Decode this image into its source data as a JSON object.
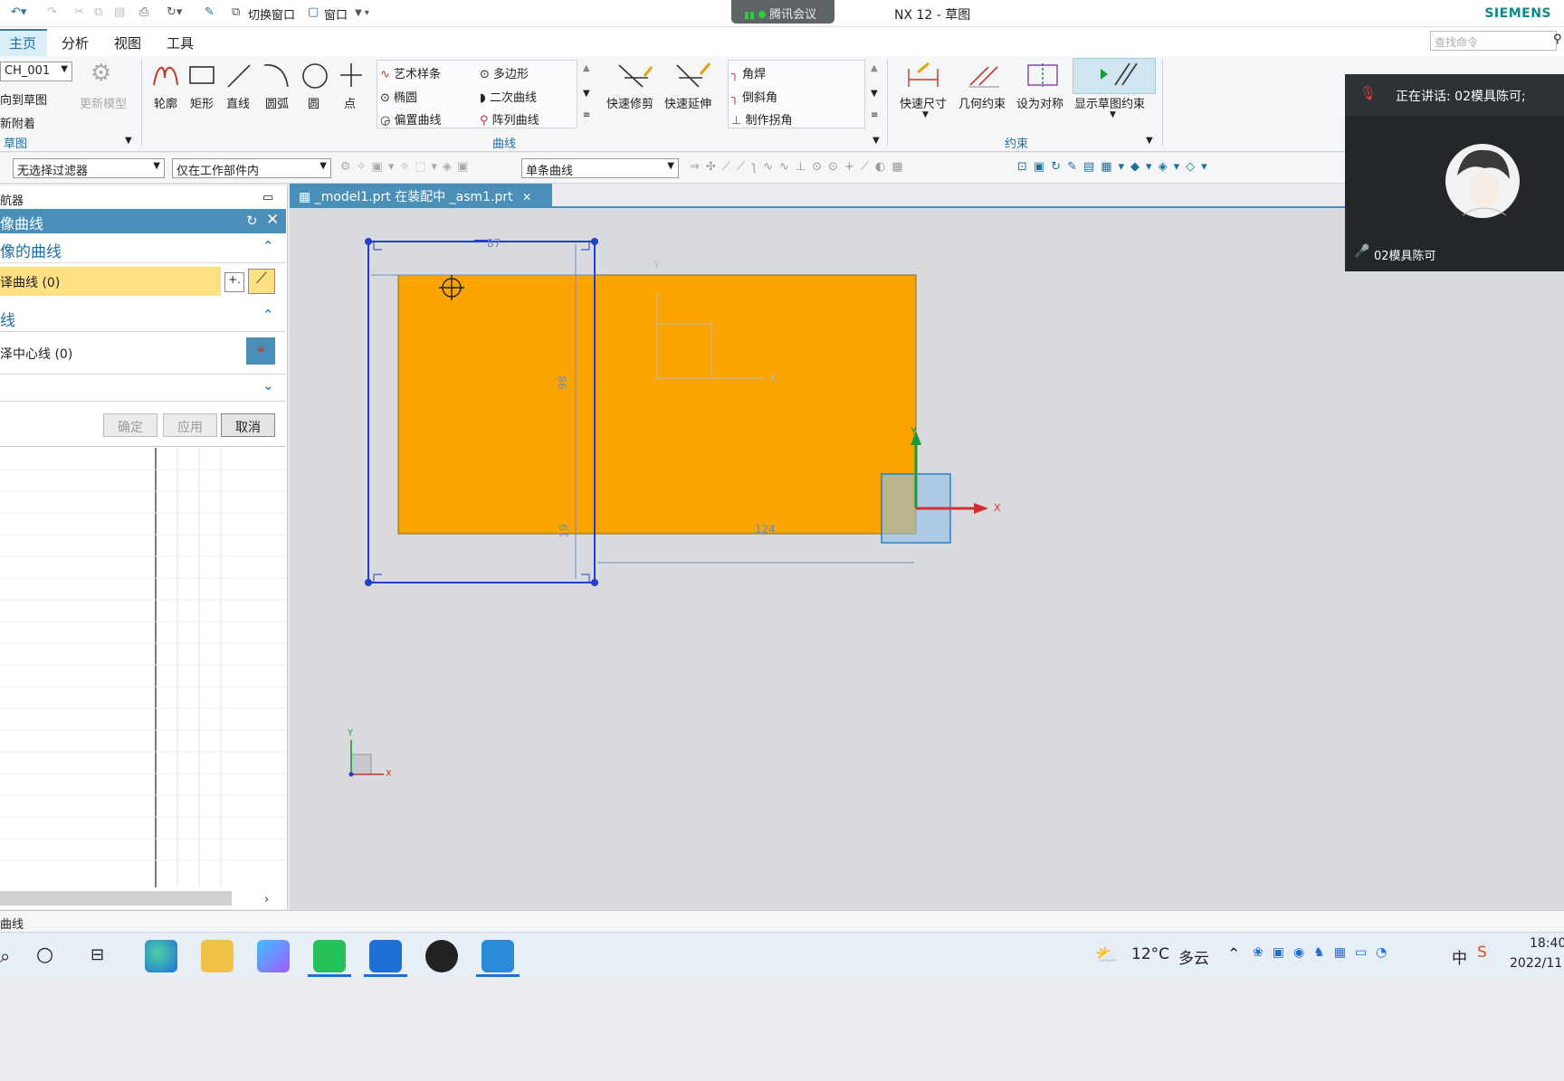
{
  "meeting": {
    "app_name": "腾讯会议",
    "speaking": "正在讲话: 02模具陈可;",
    "participant": "02模具陈可"
  },
  "window": {
    "title": "NX 12 - 草图",
    "brand": "SIEMENS"
  },
  "quick_access": {
    "switch_window": "切换窗口",
    "window": "窗口"
  },
  "menu": {
    "tabs": [
      "主页",
      "分析",
      "视图",
      "工具"
    ],
    "search_placeholder": "查找命令"
  },
  "ribbon": {
    "sketch_group": {
      "name_combo": "CH_001",
      "orient": "向到草图",
      "reattach": "新附着",
      "update_model": "更新模型",
      "label": "草图"
    },
    "curve_tools": [
      "轮廓",
      "矩形",
      "直线",
      "圆弧",
      "圆",
      "点"
    ],
    "curve_list_col1": [
      "艺术样条",
      "椭圆",
      "偏置曲线"
    ],
    "curve_list_col2": [
      "多边形",
      "二次曲线",
      "阵列曲线"
    ],
    "edit_tools": [
      "快速修剪",
      "快速延伸"
    ],
    "corner_list": [
      "角焊",
      "倒斜角",
      "制作拐角"
    ],
    "curve_group_label": "曲线",
    "constraint_tools": [
      "快速尺寸",
      "几何约束",
      "设为对称",
      "显示草图约束"
    ],
    "constraint_group_label": "约束"
  },
  "filterbar": {
    "filter": "无选择过滤器",
    "scope": "仅在工作部件内",
    "curve_rule": "单条曲线"
  },
  "navigator": {
    "title": "航器"
  },
  "dialog": {
    "title": "像曲线",
    "section1": "像的曲线",
    "select_curve": "译曲线 (0)",
    "section2": "线",
    "select_centerline": "泽中心线 (0)",
    "ok": "确定",
    "apply": "应用",
    "cancel": "取消"
  },
  "doc_tab": "_model1.prt 在装配中 _asm1.prt",
  "dimensions": {
    "width": "87",
    "height": "98",
    "offset_v": "19",
    "offset_h": "124"
  },
  "axis": {
    "x": "X",
    "y": "Y"
  },
  "status": "曲线",
  "taskbar": {
    "weather_temp": "12°C",
    "weather_desc": "多云",
    "ime": "中",
    "time": "18:40",
    "date": "2022/11"
  },
  "colors": {
    "sketch_fill": "#f9a400",
    "accent": "#4a8fb7",
    "selection": "#1f3fd0"
  }
}
